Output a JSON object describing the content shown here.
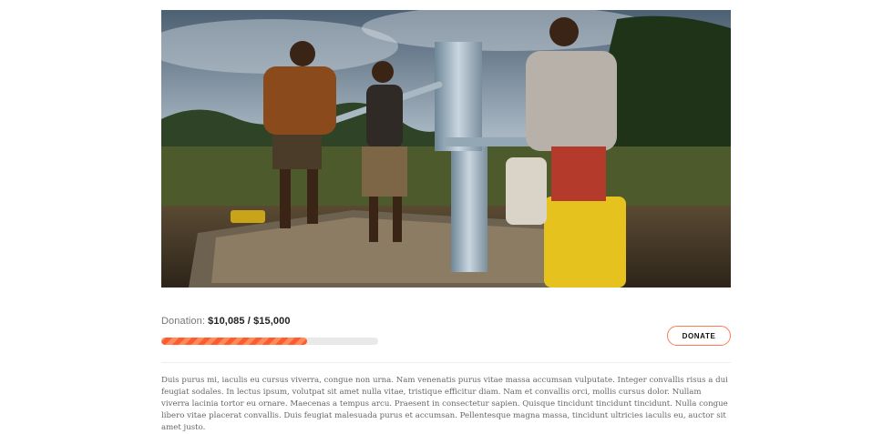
{
  "hero_image": {
    "subject": "three-children-at-water-pump"
  },
  "donation": {
    "label": "Donation:",
    "raised": "$10,085",
    "separator": " / ",
    "goal": "$15,000",
    "progress_fraction": 0.6723
  },
  "actions": {
    "donate_label": "DONATE"
  },
  "description": {
    "text": "Duis purus mi, iaculis eu cursus viverra, congue non urna. Nam venenatis purus vitae massa accumsan vulputate. Integer convallis risus a dui feugiat sodales. In lectus ipsum, volutpat sit amet nulla vitae, tristique efficitur diam. Nam et convallis orci, mollis cursus dolor. Nullam viverra lacinia tortor eu ornare. Maecenas a tempus arcu. Praesent in consectetur sapien. Quisque tincidunt tincidunt tincidunt. Nulla congue libero vitae placerat convallis. Duis feugiat malesuada purus et accumsan. Pellentesque magna massa, tincidunt ultricies iaculis eu, auctor sit amet justo."
  },
  "colors": {
    "accent": "#ff5b2e",
    "accent_light": "#ff8a5c",
    "track": "#e9e9e9",
    "button_border": "#ff7a55"
  }
}
